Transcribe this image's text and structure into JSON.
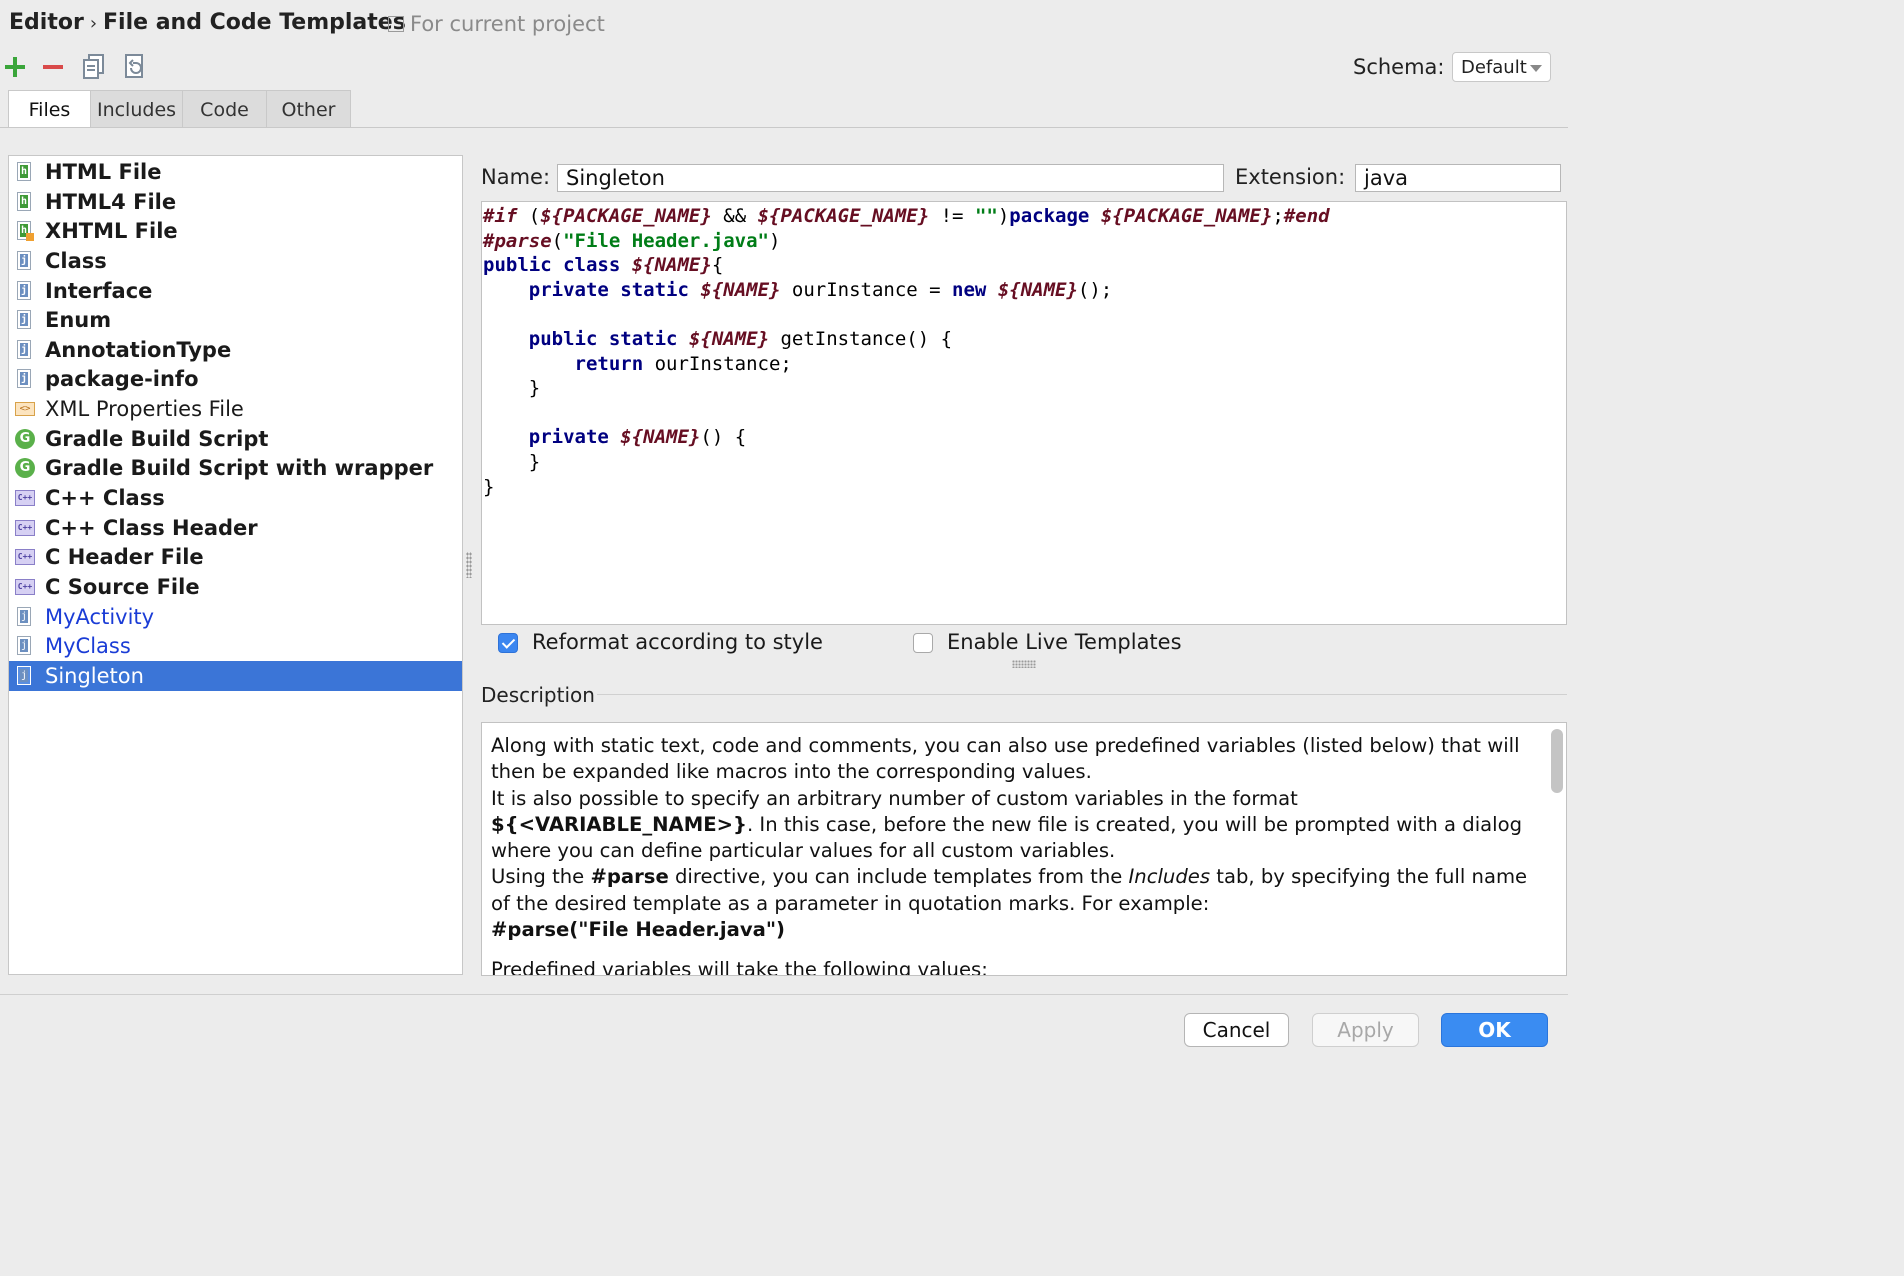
{
  "breadcrumb": {
    "parent": "Editor",
    "separator": "›",
    "current": "File and Code Templates"
  },
  "scope_label": "For current project",
  "toolbar": {
    "add_icon": "plus-icon",
    "remove_icon": "minus-icon",
    "copy_icon": "copy-icon",
    "reset_icon": "reset-icon",
    "schema_label": "Schema:",
    "schema_value": "Default"
  },
  "tabs": [
    {
      "label": "Files",
      "active": true
    },
    {
      "label": "Includes",
      "active": false
    },
    {
      "label": "Code",
      "active": false
    },
    {
      "label": "Other",
      "active": false
    }
  ],
  "templates": [
    {
      "label": "HTML File",
      "icon": "html-file-icon"
    },
    {
      "label": "HTML4 File",
      "icon": "html-file-icon"
    },
    {
      "label": "XHTML File",
      "icon": "xhtml-file-icon"
    },
    {
      "label": "Class",
      "icon": "java-file-icon"
    },
    {
      "label": "Interface",
      "icon": "java-file-icon"
    },
    {
      "label": "Enum",
      "icon": "java-file-icon"
    },
    {
      "label": "AnnotationType",
      "icon": "java-file-icon"
    },
    {
      "label": "package-info",
      "icon": "java-file-icon"
    },
    {
      "label": "XML Properties File",
      "icon": "xml-file-icon"
    },
    {
      "label": "Gradle Build Script",
      "icon": "gradle-icon"
    },
    {
      "label": "Gradle Build Script with wrapper",
      "icon": "gradle-icon"
    },
    {
      "label": "C++ Class",
      "icon": "cpp-file-icon"
    },
    {
      "label": "C++ Class Header",
      "icon": "cpp-file-icon"
    },
    {
      "label": "C Header File",
      "icon": "cpp-file-icon"
    },
    {
      "label": "C Source File",
      "icon": "cpp-file-icon"
    },
    {
      "label": "MyActivity",
      "icon": "java-file-icon"
    },
    {
      "label": "MyClass",
      "icon": "java-file-icon"
    },
    {
      "label": "Singleton",
      "icon": "java-file-icon"
    }
  ],
  "selected_template": "Singleton",
  "name_label": "Name:",
  "name_value": "Singleton",
  "extension_label": "Extension:",
  "extension_value": "java",
  "code_lines": [
    "#if (${PACKAGE_NAME} && ${PACKAGE_NAME} != \"\")package ${PACKAGE_NAME};#end",
    "#parse(\"File Header.java\")",
    "public class ${NAME}{",
    "    private static ${NAME} ourInstance = new ${NAME}();",
    "",
    "    public static ${NAME} getInstance() {",
    "        return ourInstance;",
    "    }",
    "",
    "    private ${NAME}() {",
    "    }",
    "}"
  ],
  "options": {
    "reformat_label": "Reformat according to style",
    "reformat_checked": true,
    "live_templates_label": "Enable Live Templates",
    "live_templates_checked": false
  },
  "description": {
    "title": "Description",
    "p1": "Along with static text, code and comments, you can also use predefined variables (listed below) that will then be expanded like macros into the corresponding values.",
    "p2a": "It is also possible to specify an arbitrary number of custom variables in the format ",
    "p2b": "${<VARIABLE_NAME>}",
    "p2c": ". In this case, before the new file is created, you will be prompted with a dialog where you can define particular values for all custom variables.",
    "p3a": "Using the ",
    "p3b": "#parse",
    "p3c": " directive, you can include templates from the ",
    "p3d": "Includes",
    "p3e": " tab, by specifying the full name of the desired template as a parameter in quotation marks. For example:",
    "p4": "#parse(\"File Header.java\")",
    "p5": "Predefined variables will take the following values:"
  },
  "buttons": {
    "cancel": "Cancel",
    "apply": "Apply",
    "ok": "OK"
  }
}
